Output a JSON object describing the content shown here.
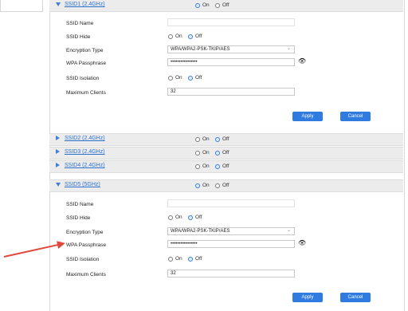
{
  "ssid1": {
    "title": "SSID1 (2.4GHz)",
    "enable": {
      "on": "On",
      "off": "Off"
    },
    "fields": {
      "name_label": "SSID Name",
      "name_value": "",
      "hide_label": "SSID Hide",
      "hide_on": "On",
      "hide_off": "Off",
      "enc_label": "Encryption Type",
      "enc_value": "WPA/WPA2-PSK-TKIP/AES",
      "wpa_label": "WPA Passphrase",
      "wpa_value": "••••••••••••••••",
      "iso_label": "SSID Isolation",
      "iso_on": "On",
      "iso_off": "Off",
      "max_label": "Maximum Clients",
      "max_value": "32"
    },
    "apply": "Apply",
    "cancel": "Cancel"
  },
  "collapsed": [
    {
      "title": "SSID2 (2.4GHz)",
      "on": "On",
      "off": "Off"
    },
    {
      "title": "SSID3 (2.4GHz)",
      "on": "On",
      "off": "Off"
    },
    {
      "title": "SSID4 (2.4GHz)",
      "on": "On",
      "off": "Off"
    }
  ],
  "ssid5": {
    "title": "SSID5 (5GHz)",
    "enable": {
      "on": "On",
      "off": "Off"
    },
    "fields": {
      "name_label": "SSID Name",
      "name_value": "",
      "hide_label": "SSID Hide",
      "hide_on": "On",
      "hide_off": "Off",
      "enc_label": "Encryption Type",
      "enc_value": "WPA/WPA2-PSK-TKIP/AES",
      "wpa_label": "WPA Passphrase",
      "wpa_value": "••••••••••••••••",
      "iso_label": "SSID Isolation",
      "iso_on": "On",
      "iso_off": "Off",
      "max_label": "Maximum Clients",
      "max_value": "32"
    },
    "apply": "Apply",
    "cancel": "Cancel"
  },
  "icons": {
    "expanded": "triangle-down-icon",
    "collapsed": "triangle-right-icon",
    "show_password": "eye-icon",
    "annotation": "red-arrow"
  },
  "colors": {
    "accent": "#2f7be0",
    "link": "#2b6fcf",
    "header_bg": "#ececec",
    "annotation": "#e0483d"
  }
}
